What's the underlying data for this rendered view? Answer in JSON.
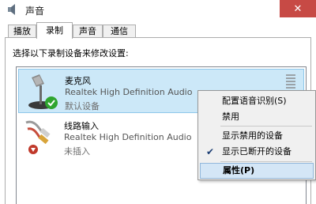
{
  "window": {
    "title": "声音",
    "close_symbol": "✕"
  },
  "tabs": [
    {
      "label": "播放"
    },
    {
      "label": "录制"
    },
    {
      "label": "声音"
    },
    {
      "label": "通信"
    }
  ],
  "instruction": "选择以下录制设备来修改设置:",
  "devices": [
    {
      "name": "麦克风",
      "description": "Realtek High Definition Audio",
      "status": "默认设备",
      "icon": "microphone-icon"
    },
    {
      "name": "线路输入",
      "description": "Realtek High Definition Audio",
      "status": "未插入",
      "icon": "line-in-icon"
    }
  ],
  "context_menu": {
    "items": [
      {
        "label": "配置语音识别(S)"
      },
      {
        "label": "禁用"
      },
      {
        "label": "显示禁用的设备"
      },
      {
        "label": "显示已断开的设备",
        "checked": true
      },
      {
        "label": "属性(P)"
      }
    ]
  },
  "colors": {
    "close_button": "#c74a45",
    "selection": "#cce8f8",
    "menu_highlight": "#d4e6f6",
    "default_check": "#2fa52f",
    "unplugged_badge": "#c0392b"
  }
}
